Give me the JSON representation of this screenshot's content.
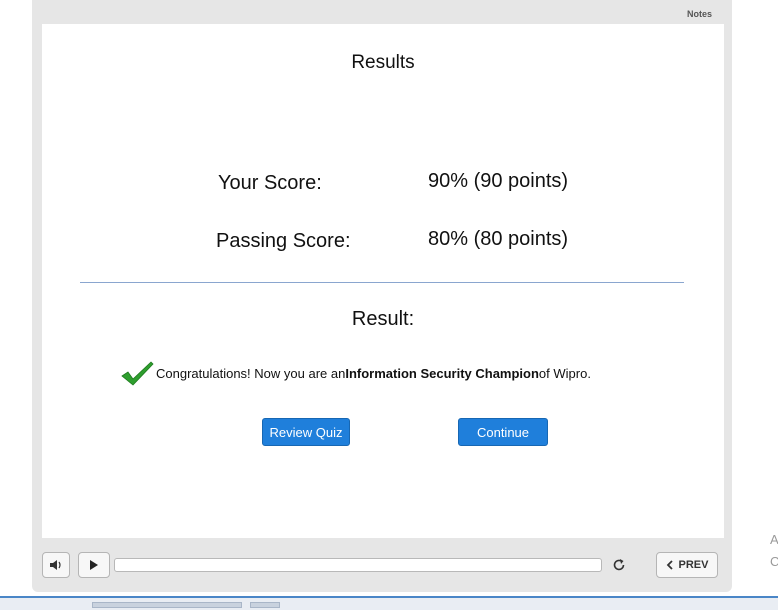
{
  "player": {
    "notes_tab": "Notes"
  },
  "slide": {
    "title": "Results",
    "your_score_label": "Your Score:",
    "your_score_value": "90% (90 points)",
    "passing_score_label": "Passing Score:",
    "passing_score_value": "80% (80 points)",
    "result_heading": "Result:",
    "message_prefix": "Congratulations! Now you are an ",
    "message_bold": "Information Security Champion",
    "message_suffix": " of Wipro.",
    "review_button": "Review Quiz",
    "continue_button": "Continue"
  },
  "controls": {
    "prev_label": "PREV",
    "progress": 0.0,
    "icons": {
      "volume": "speaker-icon",
      "play": "play-icon",
      "replay": "replay-icon",
      "prev": "chevron-left-icon"
    }
  },
  "side_text": {
    "line1": "A",
    "line2": "C"
  },
  "colors": {
    "accent": "#1f7fdb",
    "check": "#2e9e2e",
    "divider": "#8aa6cf"
  }
}
